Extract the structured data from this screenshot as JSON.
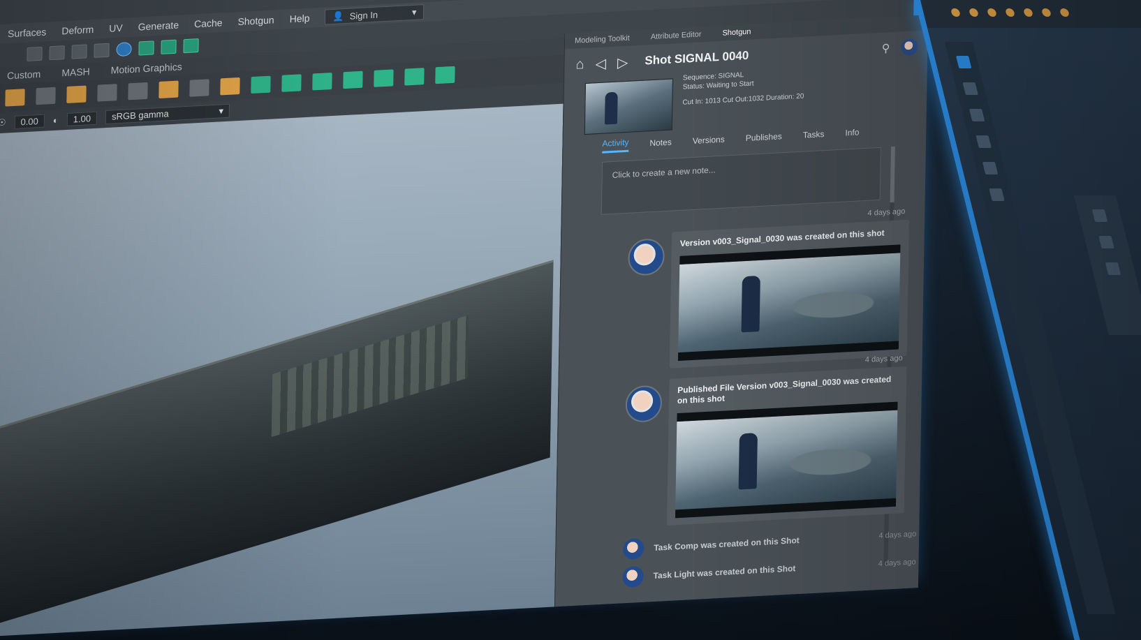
{
  "menubar": {
    "items": [
      "Surfaces",
      "Deform",
      "UV",
      "Generate",
      "Cache",
      "Shotgun",
      "Help"
    ],
    "signin_label": "Sign In"
  },
  "shelf_tabs": [
    "Custom",
    "MASH",
    "Motion Graphics"
  ],
  "viewbar": {
    "value_a": "0.00",
    "value_b": "1.00",
    "color_space": "sRGB gamma"
  },
  "panel": {
    "tabs": [
      "Modeling Toolkit",
      "Attribute Editor",
      "Shotgun"
    ],
    "shot_title": "Shot SIGNAL 0040",
    "sequence": "Sequence: SIGNAL",
    "status": "Status: Waiting to Start",
    "cut_line": "Cut In: 1013 Cut Out:1032 Duration: 20",
    "detail_tabs": [
      "Activity",
      "Notes",
      "Versions",
      "Publishes",
      "Tasks",
      "Info"
    ],
    "note_placeholder": "Click to create a new note...",
    "feed": [
      {
        "text": "Version v003_Signal_0030 was created on this shot",
        "time": "4 days ago"
      },
      {
        "text": "Published File Version v003_Signal_0030 was created on this shot",
        "time": "4 days ago"
      }
    ],
    "mini_feed": [
      {
        "text": "Task Comp was created on this Shot",
        "time": "4 days ago"
      },
      {
        "text": "Task Light was created on this Shot",
        "time": "4 days ago"
      }
    ]
  },
  "colors": {
    "accent": "#2d8fe6",
    "active_tab": "#56b6ff"
  }
}
